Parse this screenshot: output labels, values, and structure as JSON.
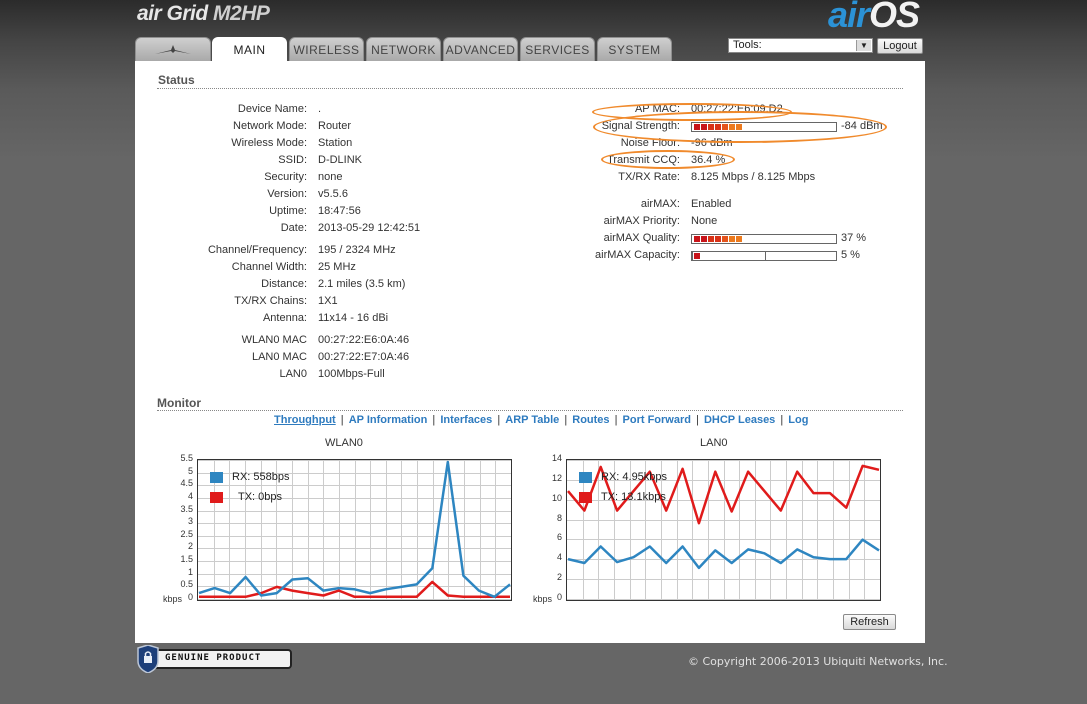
{
  "header": {
    "brand_prefix": "air Grid ",
    "brand_model": "M2HP",
    "airos_air": "air",
    "airos_os": "OS",
    "tabs": [
      {
        "label": "",
        "icon": "ubiquiti-logo-icon"
      },
      {
        "label": "MAIN",
        "active": true
      },
      {
        "label": "WIRELESS"
      },
      {
        "label": "NETWORK"
      },
      {
        "label": "ADVANCED"
      },
      {
        "label": "SERVICES"
      },
      {
        "label": "SYSTEM"
      }
    ],
    "tools_value": "Tools:",
    "logout_label": "Logout"
  },
  "status": {
    "title": "Status",
    "left": [
      {
        "label": "Device Name:",
        "value": "."
      },
      {
        "label": "Network Mode:",
        "value": "Router"
      },
      {
        "label": "Wireless Mode:",
        "value": "Station"
      },
      {
        "label": "SSID:",
        "value": "D-DLINK"
      },
      {
        "label": "Security:",
        "value": "none"
      },
      {
        "label": "Version:",
        "value": "v5.5.6"
      },
      {
        "label": "Uptime:",
        "value": "18:47:56"
      },
      {
        "label": "Date:",
        "value": "2013-05-29 12:42:51"
      },
      {
        "label": "Channel/Frequency:",
        "value": "195 / 2324 MHz"
      },
      {
        "label": "Channel Width:",
        "value": "25 MHz"
      },
      {
        "label": "Distance:",
        "value": "2.1 miles (3.5 km)"
      },
      {
        "label": "TX/RX Chains:",
        "value": "1X1"
      },
      {
        "label": "Antenna:",
        "value": "11x14 - 16 dBi"
      },
      {
        "label": "WLAN0 MAC",
        "value": "00:27:22:E6:0A:46"
      },
      {
        "label": "LAN0 MAC",
        "value": "00:27:22:E7:0A:46"
      },
      {
        "label": "LAN0",
        "value": "100Mbps-Full"
      }
    ],
    "right": [
      {
        "label": "AP MAC:",
        "value": "00:27:22:E6:09:D2"
      },
      {
        "label": "Signal Strength:",
        "value": "-84 dBm",
        "level": 0.37
      },
      {
        "label": "Noise Floor:",
        "value": "-96 dBm"
      },
      {
        "label": "Transmit CCQ:",
        "value": "36.4 %"
      },
      {
        "label": "TX/RX Rate:",
        "value": "8.125 Mbps / 8.125 Mbps"
      },
      {
        "label": "airMAX:",
        "value": "Enabled"
      },
      {
        "label": "airMAX Priority:",
        "value": "None"
      },
      {
        "label": "airMAX Quality:",
        "value": "37 %",
        "level": 0.37
      },
      {
        "label": "airMAX Capacity:",
        "value": "5 %",
        "level": 0.05
      }
    ]
  },
  "monitor": {
    "title": "Monitor",
    "links": [
      "Throughput",
      "AP Information",
      "Interfaces",
      "ARP Table",
      "Routes",
      "Port Forward",
      "DHCP Leases",
      "Log"
    ],
    "refresh_label": "Refresh"
  },
  "chart_data": [
    {
      "type": "line",
      "title": "WLAN0",
      "ylabel": "kbps",
      "ylim": [
        0,
        5.5
      ],
      "yticks": [
        "5.5",
        "5",
        "4.5",
        "4",
        "3.5",
        "3",
        "2.5",
        "2",
        "1.5",
        "1",
        "0.5",
        "0"
      ],
      "series": [
        {
          "name": "RX: 558bps",
          "color": "#2e86c1",
          "values": [
            0.2,
            0.4,
            0.2,
            0.85,
            0.1,
            0.2,
            0.75,
            0.8,
            0.3,
            0.4,
            0.35,
            0.2,
            0.35,
            0.45,
            0.55,
            1.2,
            5.5,
            0.9,
            0.3,
            0.05,
            0.55
          ]
        },
        {
          "name": "TX: 0bps",
          "color": "#e01b1b",
          "values": [
            0.05,
            0.05,
            0.05,
            0.05,
            0.2,
            0.45,
            0.3,
            0.2,
            0.1,
            0.3,
            0.05,
            0.05,
            0.05,
            0.05,
            0.05,
            0.65,
            0.1,
            0.05,
            0.05,
            0.05,
            0.05
          ]
        }
      ]
    },
    {
      "type": "line",
      "title": "LAN0",
      "ylabel": "kbps",
      "ylim": [
        0,
        14
      ],
      "yticks": [
        "14",
        "12",
        "10",
        "8",
        "6",
        "4",
        "2",
        "0"
      ],
      "series": [
        {
          "name": "RX: 4.95kbps",
          "color": "#2e86c1",
          "values": [
            4.0,
            3.6,
            5.3,
            3.7,
            4.2,
            5.3,
            3.6,
            5.3,
            3.1,
            4.9,
            3.6,
            5.0,
            4.6,
            3.6,
            5.0,
            4.2,
            4.0,
            4.0,
            6.0,
            4.9
          ]
        },
        {
          "name": "TX: 13.1kbps",
          "color": "#e01b1b",
          "values": [
            11.0,
            9.0,
            13.5,
            9.0,
            11.0,
            13.0,
            9.0,
            13.3,
            7.7,
            13.0,
            8.9,
            13.0,
            11.0,
            9.0,
            13.0,
            10.8,
            10.8,
            9.3,
            13.6,
            13.2
          ]
        }
      ]
    }
  ],
  "footer": {
    "badge_text": "GENUINE PRODUCT",
    "copyright": "© Copyright 2006-2013 Ubiquiti Networks, Inc."
  }
}
